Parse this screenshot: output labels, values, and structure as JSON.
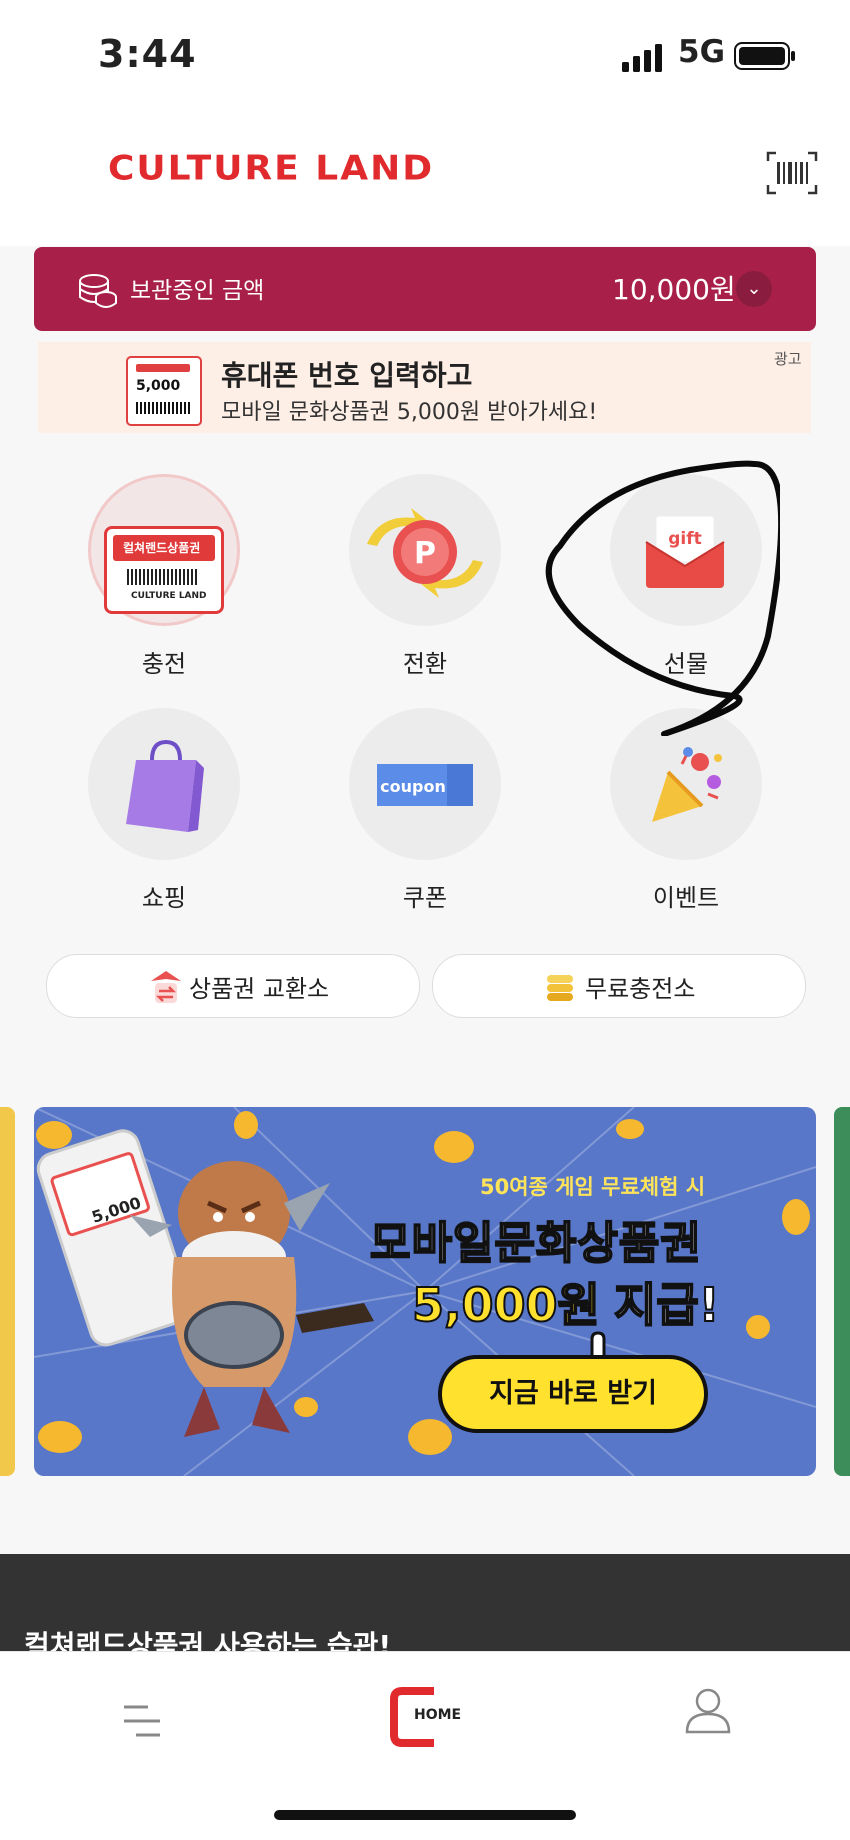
{
  "status_bar": {
    "time": "3:44",
    "network": "5G"
  },
  "header": {
    "logo_text": "CULTURE LAND",
    "barcode_icon": "barcode-icon"
  },
  "balance": {
    "label": "보관중인 금액",
    "amount": "10,000원",
    "icon": "coins-icon"
  },
  "ad": {
    "badge": "광고",
    "line1": "휴대폰 번호 입력하고",
    "line2": "모바일 문화상품권 5,000원 받아가세요!",
    "card_value": "5,000"
  },
  "menu": {
    "items": [
      {
        "label": "충전",
        "icon": "gift-card-icon",
        "card_title": "컬쳐랜드상품권",
        "card_brand": "CULTURE LAND"
      },
      {
        "label": "전환",
        "icon": "point-convert-icon",
        "letter": "P"
      },
      {
        "label": "선물",
        "icon": "gift-envelope-icon",
        "word": "gift"
      },
      {
        "label": "쇼핑",
        "icon": "shopping-bag-icon"
      },
      {
        "label": "쿠폰",
        "icon": "coupon-icon",
        "word": "coupon"
      },
      {
        "label": "이벤트",
        "icon": "party-popper-icon"
      }
    ]
  },
  "pills": {
    "exchange": "상품권 교환소",
    "free_charge": "무료충전소"
  },
  "banner": {
    "small": "50여종 게임 무료체험 시",
    "headline": "모바일문화상품권",
    "amount": "5,000원",
    "amount_suffix": "지급!",
    "button": "지금 바로 받기",
    "card_value": "5,000"
  },
  "section": {
    "title": "컬쳐랜드상품권 사용하는 습관!"
  },
  "tabbar": {
    "menu_icon": "menu-icon",
    "home_label": "HOME",
    "profile_icon": "profile-icon"
  },
  "colors": {
    "brand_red": "#e02a2e",
    "balance_bg": "#a8204a",
    "banner_bg": "#5877c9",
    "accent_yellow": "#ffe12e"
  }
}
